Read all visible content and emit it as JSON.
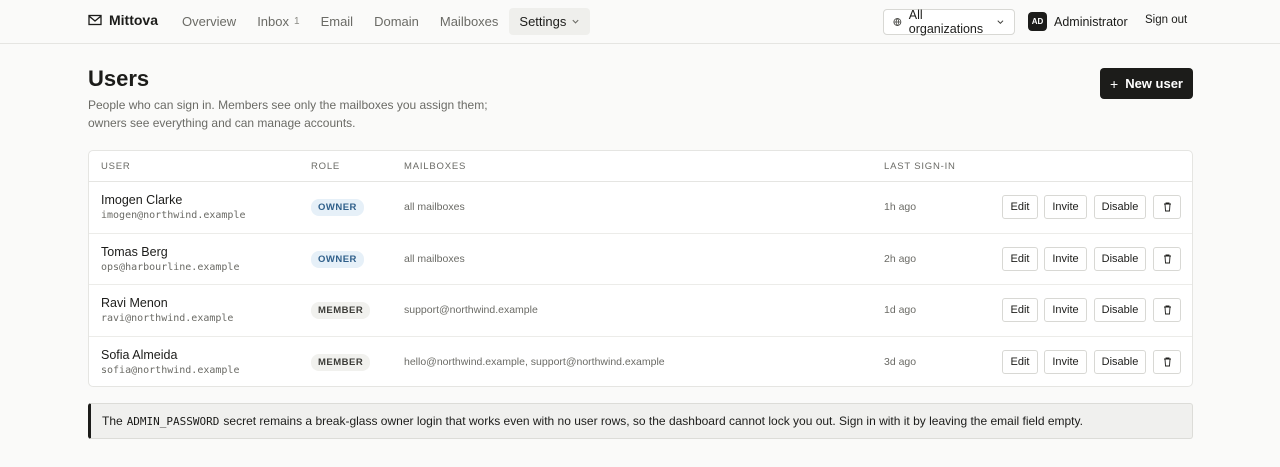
{
  "brand": {
    "name": "Mittova"
  },
  "nav": {
    "overview": "Overview",
    "inbox": "Inbox",
    "inbox_count": "1",
    "email": "Email",
    "domain": "Domain",
    "mailboxes": "Mailboxes",
    "settings": "Settings"
  },
  "org_select": {
    "value": "All organizations"
  },
  "account": {
    "initials": "AD",
    "name": "Administrator",
    "signout": "Sign out"
  },
  "page": {
    "title": "Users",
    "description": "People who can sign in. Members see only the mailboxes you assign them; owners see everything and can manage accounts.",
    "new_user": "New user"
  },
  "table": {
    "headers": {
      "user": "USER",
      "role": "ROLE",
      "mailboxes": "MAILBOXES",
      "last": "LAST SIGN-IN"
    },
    "actions": {
      "edit": "Edit",
      "invite": "Invite",
      "disable": "Disable"
    },
    "rows": [
      {
        "name": "Imogen Clarke",
        "email": "imogen@northwind.example",
        "role": "OWNER",
        "mailboxes": "all mailboxes",
        "last": "1h ago"
      },
      {
        "name": "Tomas Berg",
        "email": "ops@harbourline.example",
        "role": "OWNER",
        "mailboxes": "all mailboxes",
        "last": "2h ago"
      },
      {
        "name": "Ravi Menon",
        "email": "ravi@northwind.example",
        "role": "MEMBER",
        "mailboxes": "support@northwind.example",
        "last": "1d ago"
      },
      {
        "name": "Sofia Almeida",
        "email": "sofia@northwind.example",
        "role": "MEMBER",
        "mailboxes": "hello@northwind.example, support@northwind.example",
        "last": "3d ago"
      }
    ]
  },
  "note": {
    "before": "The",
    "code": "ADMIN_PASSWORD",
    "after": "secret remains a break-glass owner login that works even with no user rows, so the dashboard cannot lock you out. Sign in with it by leaving the email field empty."
  },
  "icons": {
    "brand": "mail-icon",
    "org": "globe-icon",
    "dropdown": "chevron-down-icon",
    "delete": "trash-icon",
    "add": "plus-icon"
  }
}
